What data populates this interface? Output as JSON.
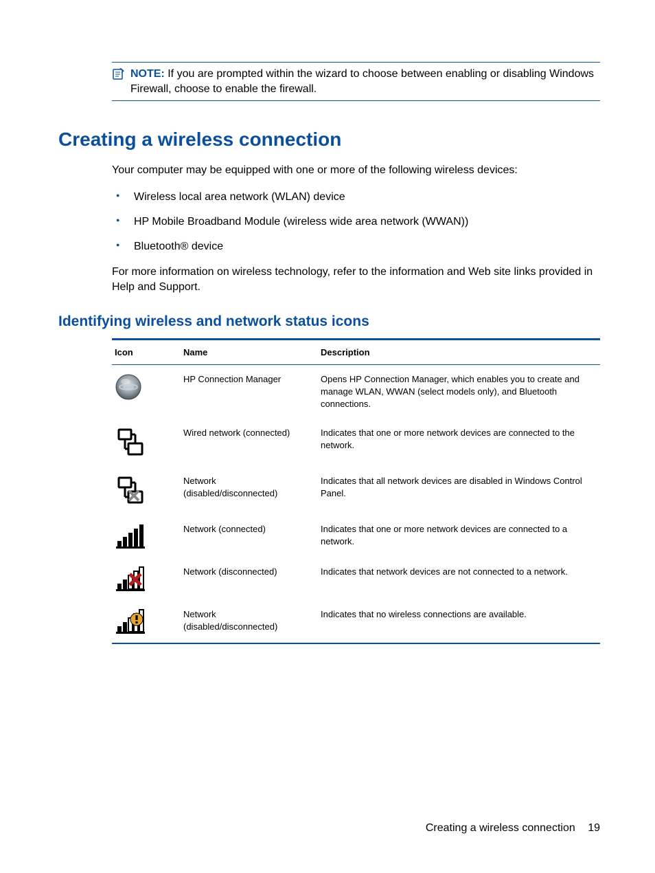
{
  "note": {
    "label": "NOTE:",
    "text": "If you are prompted within the wizard to choose between enabling or disabling Windows Firewall, choose to enable the firewall."
  },
  "heading1": "Creating a wireless connection",
  "intro": "Your computer may be equipped with one or more of the following wireless devices:",
  "bullets": [
    "Wireless local area network (WLAN) device",
    "HP Mobile Broadband Module (wireless wide area network (WWAN))",
    "Bluetooth® device"
  ],
  "moreinfo": "For more information on wireless technology, refer to the information and Web site links provided in Help and Support.",
  "heading2": "Identifying wireless and network status icons",
  "table": {
    "headers": {
      "icon": "Icon",
      "name": "Name",
      "desc": "Description"
    },
    "rows": [
      {
        "name": "HP Connection Manager",
        "desc": "Opens HP Connection Manager, which enables you to create and manage WLAN, WWAN (select models only), and Bluetooth connections."
      },
      {
        "name": "Wired network (connected)",
        "desc": "Indicates that one or more network devices are connected to the network."
      },
      {
        "name": "Network (disabled/disconnected)",
        "desc": "Indicates that all network devices are disabled in Windows Control Panel."
      },
      {
        "name": "Network (connected)",
        "desc": "Indicates that one or more network devices are connected to a network."
      },
      {
        "name": "Network (disconnected)",
        "desc": "Indicates that network devices are not connected to a network."
      },
      {
        "name": "Network (disabled/disconnected)",
        "desc": "Indicates that no wireless connections are available."
      }
    ]
  },
  "footer": {
    "title": "Creating a wireless connection",
    "page": "19"
  }
}
